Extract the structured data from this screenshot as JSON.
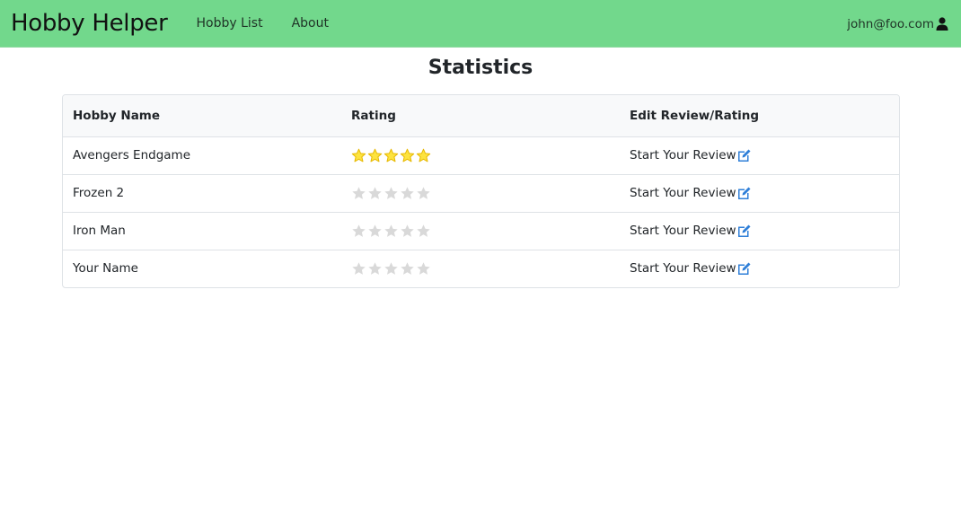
{
  "navbar": {
    "brand": "Hobby Helper",
    "links": [
      {
        "label": "Hobby List"
      },
      {
        "label": "About"
      }
    ],
    "user_email": "john@foo.com",
    "user_icon": "user-icon",
    "background": "#72d88c"
  },
  "page": {
    "title": "Statistics"
  },
  "table": {
    "headers": [
      "Hobby Name",
      "Rating",
      "Edit Review/Rating"
    ],
    "rows": [
      {
        "name": "Avengers Endgame",
        "rating": 5,
        "max_rating": 5,
        "action": "Start Your Review"
      },
      {
        "name": "Frozen 2",
        "rating": 0,
        "max_rating": 5,
        "action": "Start Your Review"
      },
      {
        "name": "Iron Man",
        "rating": 0,
        "max_rating": 5,
        "action": "Start Your Review"
      },
      {
        "name": "Your Name",
        "rating": 0,
        "max_rating": 5,
        "action": "Start Your Review"
      }
    ]
  },
  "colors": {
    "star_filled": "#fde33f",
    "star_filled_outline": "#e6b800",
    "star_empty": "#d9d9d9",
    "edit_icon": "#2f7fd8"
  }
}
